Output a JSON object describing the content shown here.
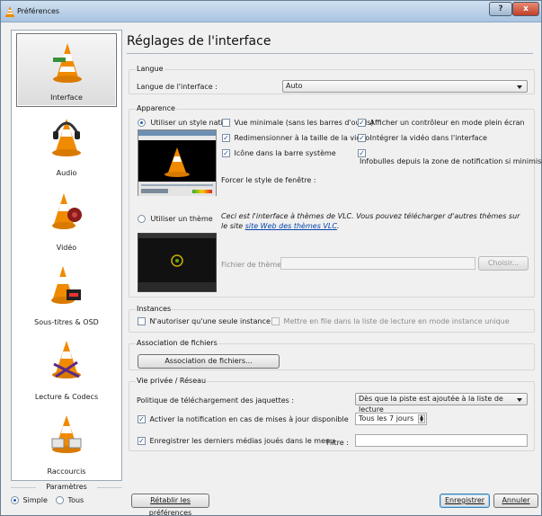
{
  "window": {
    "title": "Préférences",
    "help_btn": "?",
    "close_btn": "x"
  },
  "sidebar": {
    "items": [
      {
        "label": "Interface",
        "icon": "cone-interface-icon",
        "selected": true
      },
      {
        "label": "Audio",
        "icon": "cone-headphones-icon"
      },
      {
        "label": "Vidéo",
        "icon": "cone-video-icon"
      },
      {
        "label": "Sous-titres & OSD",
        "icon": "cone-subtitles-icon"
      },
      {
        "label": "Lecture & Codecs",
        "icon": "cone-codecs-icon"
      },
      {
        "label": "Raccourcis",
        "icon": "cone-shortcuts-icon"
      }
    ]
  },
  "params": {
    "title": "Paramètres",
    "simple": "Simple",
    "all": "Tous",
    "selected": "simple"
  },
  "page": {
    "title": "Réglages de l'interface"
  },
  "langue": {
    "group": "Langue",
    "label": "Langue de l'interface :",
    "value": "Auto"
  },
  "apparence": {
    "group": "Apparence",
    "native_style": "Utiliser un style natif",
    "minimal_view": "Vue minimale (sans les barres d'outils)",
    "fullscreen_ctrl": "Afficher un contrôleur en mode plein écran",
    "resize_video": "Redimensionner à la taille de la vidéo",
    "embed_video": "Intégrer la vidéo dans l'interface",
    "systray": "Icône dans la barre système",
    "tooltips_notify": "Infobulles depuis la zone de notification si minimisé",
    "force_style": "Forcer le style de fenêtre :",
    "use_theme": "Utiliser un thème",
    "theme_desc": "Ceci est l'interface à thèmes de VLC. Vous pouvez télécharger d'autres thèmes sur le site ",
    "theme_link": "site Web des thèmes VLC",
    "theme_link_end": ".",
    "theme_file": "Fichier de thème :",
    "choose": "Choisir..."
  },
  "instances": {
    "group": "Instances",
    "single": "N'autoriser qu'une seule instance",
    "enqueue": "Mettre en file dans la liste de lecture en mode instance unique"
  },
  "assoc": {
    "group": "Association de fichiers",
    "button": "Association de fichiers..."
  },
  "privacy": {
    "group": "Vie privée / Réseau",
    "art_policy": "Politique de téléchargement des jaquettes :",
    "art_value": "Dès que la piste est ajoutée à la liste de lecture",
    "update_notify": "Activer la notification en cas de mises à jour disponible",
    "update_value": "Tous les 7 jours",
    "save_recent": "Enregistrer les derniers médias joués dans le menu",
    "filter": "Filtre :"
  },
  "footer": {
    "reset": "Rétablir les préférences",
    "save": "Enregistrer",
    "cancel": "Annuler"
  },
  "colors": {
    "cone_orange": "#f08a00",
    "selection_blue": "#1e5fb2",
    "link": "#0645ad"
  }
}
